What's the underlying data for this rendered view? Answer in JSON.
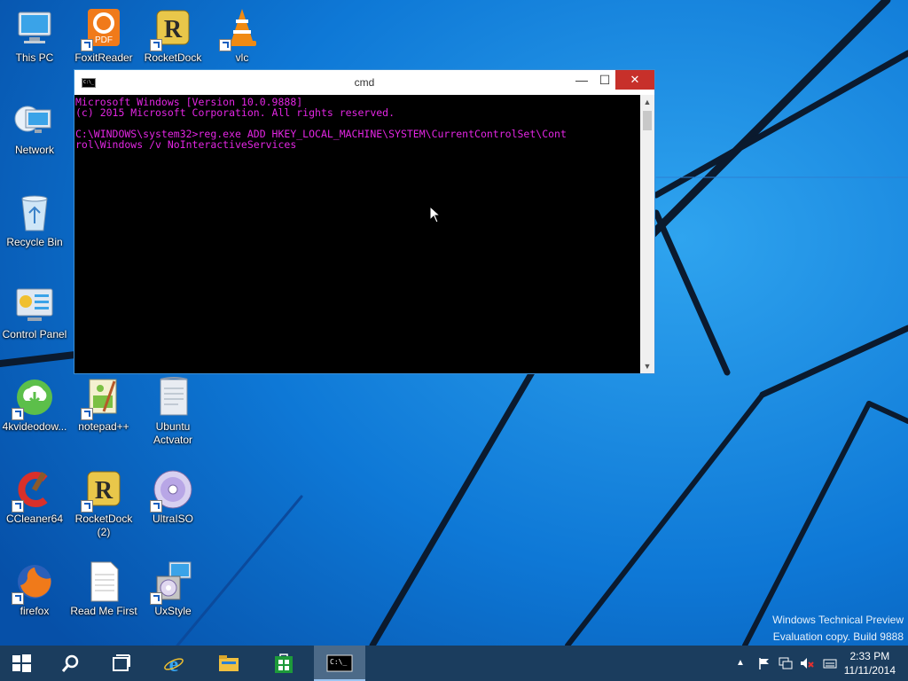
{
  "desktop": {
    "icons": [
      {
        "label": "This PC",
        "icon": "computer-icon"
      },
      {
        "label": "FoxitReader",
        "icon": "foxit-pdf-icon"
      },
      {
        "label": "RocketDock",
        "icon": "rocketdock-icon"
      },
      {
        "label": "vlc",
        "icon": "vlc-cone-icon"
      },
      {
        "label": "Network",
        "icon": "network-icon"
      },
      {
        "label": "Recycle Bin",
        "icon": "recycle-bin-icon"
      },
      {
        "label": "Control Panel",
        "icon": "control-panel-icon"
      },
      {
        "label": "4kvideodow...",
        "icon": "4k-downloader-icon"
      },
      {
        "label": "notepad++",
        "icon": "notepad-plus-plus-icon"
      },
      {
        "label": "Ubuntu Actvator",
        "icon": "ubuntu-activator-icon"
      },
      {
        "label": "CCleaner64",
        "icon": "ccleaner-icon"
      },
      {
        "label": "RocketDock (2)",
        "icon": "rocketdock-icon"
      },
      {
        "label": "UltraISO",
        "icon": "ultraiso-disc-icon"
      },
      {
        "label": "firefox",
        "icon": "firefox-icon"
      },
      {
        "label": "Read Me First",
        "icon": "text-document-icon"
      },
      {
        "label": "UxStyle",
        "icon": "uxstyle-installer-icon"
      }
    ]
  },
  "cmd_window": {
    "title": "cmd",
    "minimize": "—",
    "maximize": "☐",
    "close": "✕",
    "console_text": "Microsoft Windows [Version 10.0.9888]\n(c) 2015 Microsoft Corporation. All rights reserved.\n\nC:\\WINDOWS\\system32>reg.exe ADD HKEY_LOCAL_MACHINE\\SYSTEM\\CurrentControlSet\\Cont\nrol\\Windows /v NoInteractiveServices",
    "text_color": "#e326e3"
  },
  "watermark": {
    "line1": "Windows Technical Preview",
    "line2": "Evaluation copy. Build 9888"
  },
  "taskbar": {
    "items": [
      "start-windows-icon",
      "search-magnifier-icon",
      "task-view-icon",
      "internet-explorer-icon",
      "file-explorer-icon",
      "store-icon",
      "cmd-icon"
    ],
    "clock_time": "2:33 PM",
    "clock_date": "11/11/2014"
  },
  "colors": {
    "wallpaper": "#0a63c7",
    "taskbar": "#1b3d5e",
    "close_button": "#c7302a"
  }
}
